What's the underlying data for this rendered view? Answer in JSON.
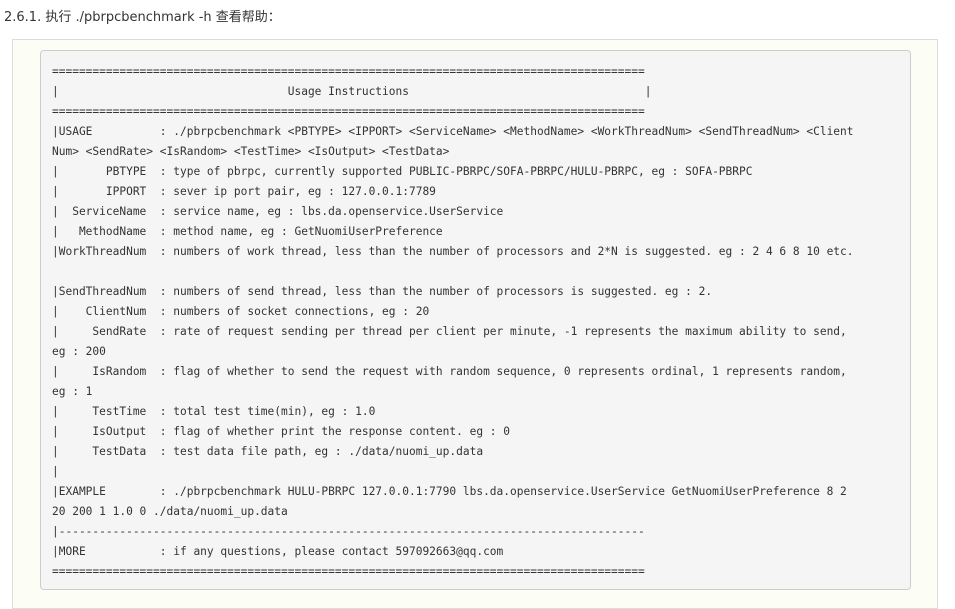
{
  "heading": "2.6.1. 执行 ./pbrpcbenchmark -h 查看帮助：",
  "code_lines": [
    "========================================================================================",
    "|                                  Usage Instructions                                   |",
    "========================================================================================",
    "|USAGE          : ./pbrpcbenchmark <PBTYPE> <IPPORT> <ServiceName> <MethodName> <WorkThreadNum> <SendThreadNum> <Client",
    "Num> <SendRate> <IsRandom> <TestTime> <IsOutput> <TestData>",
    "|       PBTYPE  : type of pbrpc, currently supported PUBLIC-PBRPC/SOFA-PBRPC/HULU-PBRPC, eg : SOFA-PBRPC",
    "|       IPPORT  : sever ip port pair, eg : 127.0.0.1:7789",
    "|  ServiceName  : service name, eg : lbs.da.openservice.UserService",
    "|   MethodName  : method name, eg : GetNuomiUserPreference",
    "|WorkThreadNum  : numbers of work thread, less than the number of processors and 2*N is suggested. eg : 2 4 6 8 10 etc.",
    "",
    "|SendThreadNum  : numbers of send thread, less than the number of processors is suggested. eg : 2.",
    "|    ClientNum  : numbers of socket connections, eg : 20",
    "|     SendRate  : rate of request sending per thread per client per minute, -1 represents the maximum ability to send,",
    "eg : 200",
    "|     IsRandom  : flag of whether to send the request with random sequence, 0 represents ordinal, 1 represents random,",
    "eg : 1",
    "|     TestTime  : total test time(min), eg : 1.0",
    "|     IsOutput  : flag of whether print the response content. eg : 0",
    "|     TestData  : test data file path, eg : ./data/nuomi_up.data",
    "|",
    "|EXAMPLE        : ./pbrpcbenchmark HULU-PBRPC 127.0.0.1:7790 lbs.da.openservice.UserService GetNuomiUserPreference 8 2",
    "20 200 1 1.0 0 ./data/nuomi_up.data",
    "|---------------------------------------------------------------------------------------",
    "|MORE           : if any questions, please contact 597092663@qq.com",
    "========================================================================================"
  ]
}
